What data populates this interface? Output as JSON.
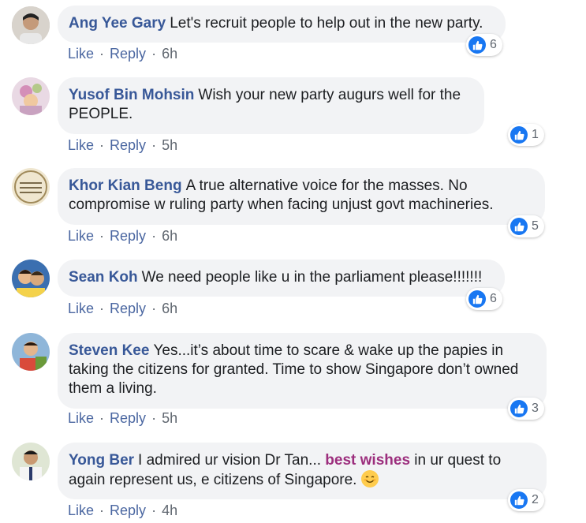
{
  "actions": {
    "like": "Like",
    "reply": "Reply",
    "separator": "·"
  },
  "comments": [
    {
      "author": "Ang Yee Gary",
      "text": "Let's recruit people to help out in the new party.",
      "time": "6h",
      "likes": "6"
    },
    {
      "author": "Yusof Bin Mohsin",
      "text": "Wish your new party augurs well for the PEOPLE.",
      "time": "5h",
      "likes": "1"
    },
    {
      "author": "Khor Kian Beng",
      "text": "A true alternative voice for the masses. No compromise w ruling party when facing unjust govt machineries.",
      "time": "6h",
      "likes": "5"
    },
    {
      "author": "Sean Koh",
      "text": "We need people like u in the parliament please!!!!!!!",
      "time": "6h",
      "likes": "6"
    },
    {
      "author": "Steven Kee",
      "text": "Yes...it’s about time to scare & wake up the papies in taking the citizens for granted. Time to show Singapore don’t owned them a living.",
      "time": "5h",
      "likes": "3"
    },
    {
      "author": "Yong Ber",
      "text_before": "I admired ur vision Dr Tan...",
      "highlight": "best wishes",
      "text_after": "in ur quest to again represent us, e citizens of Singapore.",
      "emoji": "smiling-face-icon",
      "time": "4h",
      "likes": "2"
    }
  ],
  "colors": {
    "author": "#385898",
    "highlight": "#9c2e7d",
    "like_blue": "#1877f2",
    "bubble": "#f2f3f5"
  }
}
